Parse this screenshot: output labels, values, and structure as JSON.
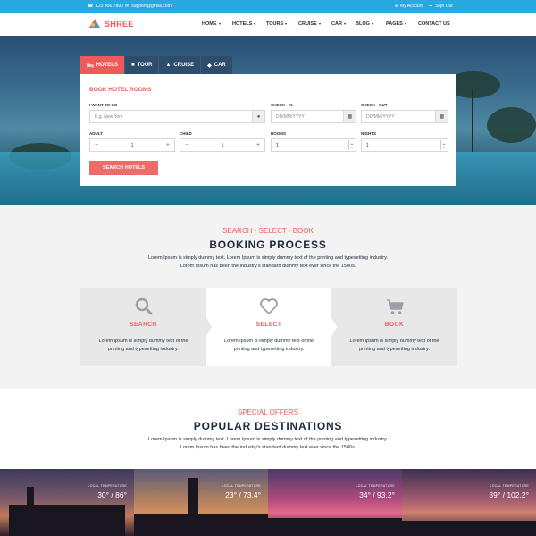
{
  "topbar": {
    "phone": "123 456 7890",
    "email": "support@gmail.com",
    "account": "My Account",
    "signout": "Sign Out"
  },
  "brand": {
    "name": "SHREE",
    "color": "#ee5a5a"
  },
  "nav": {
    "items": [
      "HOME",
      "HOTELS",
      "TOURS",
      "CRUISE",
      "CAR",
      "BLOG",
      "PAGES",
      "CONTACT US"
    ]
  },
  "booking": {
    "tabs": [
      {
        "label": "HOTELS",
        "icon": "bed-icon"
      },
      {
        "label": "TOUR",
        "icon": "suitcase-icon"
      },
      {
        "label": "CRUISE",
        "icon": "ship-icon"
      },
      {
        "label": "CAR",
        "icon": "car-icon"
      }
    ],
    "title": "BOOK HOTEL ROOMS",
    "destination_label": "I WANT TO GO",
    "destination_placeholder": "E.g. New York",
    "checkin_label": "CHECK - IN",
    "checkin_placeholder": "DD/MM/YYYY",
    "checkout_label": "CHECK - OUT",
    "checkout_placeholder": "DD/MM/YYYY",
    "adult_label": "ADULT",
    "adult_value": "1",
    "child_label": "CHILD",
    "child_value": "1",
    "rooms_label": "ROOMS",
    "rooms_value": "1",
    "nights_label": "NIGHTS",
    "nights_value": "1",
    "search_label": "SEARCH HOTELS"
  },
  "process": {
    "kicker": "SEARCH - SELECT - BOOK",
    "title": "BOOKING PROCESS",
    "desc_line1": "Lorem Ipsum is simply dummy text. Lorem Ipsum is simply dummy text of the printing and typesetting industry.",
    "desc_line2": "Lorem Ipsum has been the industry's standard dummy text ever since the 1500s.",
    "steps": [
      {
        "label": "SEARCH",
        "icon": "search-icon",
        "text_line1": "Lorem Ipsum is simply dummy text of the",
        "text_line2": "printing and typesetting industry."
      },
      {
        "label": "SELECT",
        "icon": "heart-icon",
        "text_line1": "Lorem Ipsum is simply dummy text of the",
        "text_line2": "printing and typesetting industry."
      },
      {
        "label": "BOOK",
        "icon": "cart-icon",
        "text_line1": "Lorem Ipsum is simply dummy text of the",
        "text_line2": "printing and typesetting industry."
      }
    ]
  },
  "destinations": {
    "kicker": "SPECIAL OFFERS",
    "title": "POPULAR DESTINATIONS",
    "desc_line1": "Lorem Ipsum is simply dummy text. Lorem Ipsum is simply dummy text of the printing and typesetting industry.",
    "desc_line2": "Lorem Ipsum has been the industry's standard dummy text ever since the 1500s.",
    "cards": [
      {
        "temp_label": "LOCAL TEMPERATURE",
        "temp": "30° / 86°"
      },
      {
        "temp_label": "LOCAL TEMPERATURE",
        "temp": "23° / 73.4°"
      },
      {
        "temp_label": "LOCAL TEMPERATURE",
        "temp": "34° / 93.2°"
      },
      {
        "temp_label": "LOCAL TEMPERATURE",
        "temp": "39° / 102.2°"
      }
    ]
  }
}
